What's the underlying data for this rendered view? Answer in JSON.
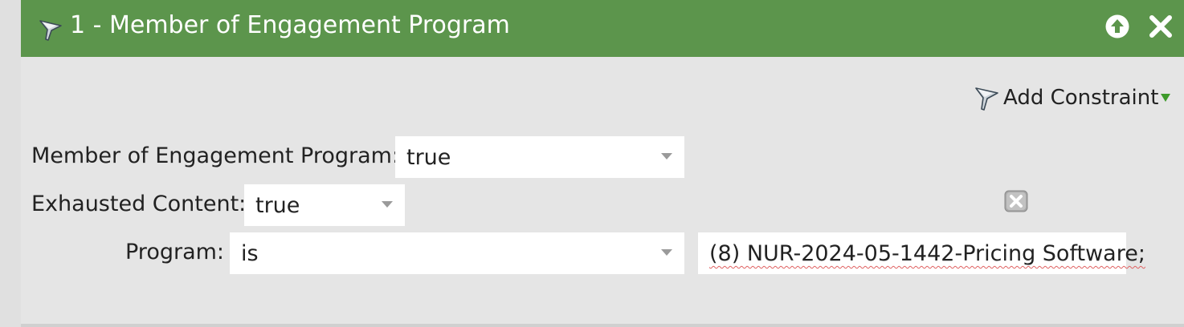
{
  "header": {
    "title": "1 - Member of Engagement Program",
    "icons": {
      "filter": "filter-icon",
      "up": "arrow-up-icon",
      "close": "close-icon"
    },
    "background": "#5c954c"
  },
  "add_constraint": {
    "label": "Add Constraint",
    "icon": "filter-icon",
    "caret": "caret-down-icon",
    "caret_color": "#3e9a2a"
  },
  "constraints": {
    "member": {
      "label": "Member of Engagement Program:",
      "value": "true"
    },
    "exhausted": {
      "label": "Exhausted Content:",
      "value": "true"
    },
    "program": {
      "label": "Program:",
      "operator": "is",
      "value": "(8) NUR-2024-05-1442-Pricing Software;"
    }
  },
  "delete_icon": "delete-constraint-icon"
}
